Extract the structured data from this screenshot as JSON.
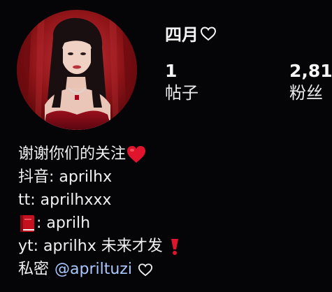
{
  "profile": {
    "username": "四月",
    "username_icon": "heart-outline-icon",
    "avatar": "profile-photo"
  },
  "stats": {
    "posts_count": "1",
    "posts_label": "帖子",
    "followers_count": "2,81",
    "followers_label": "粉丝"
  },
  "bio": {
    "line1_text": "谢谢你们的关注",
    "line1_icon": "red-heart-emoji-icon",
    "line2_text": "抖音: aprilhx",
    "line3_text": "tt: aprilhxxx",
    "line4_icon": "red-book-emoji-icon",
    "line4_text": ": aprilh",
    "line5_text": "yt: aprilhx 未来才发",
    "line5_icon": "red-exclamation-emoji-icon",
    "line6_prefix": "私密",
    "line6_mention": "@apriltuzi",
    "line6_icon": "white-heart-outline-icon"
  },
  "colors": {
    "background": "#050507",
    "text": "#f0f0f0",
    "mention": "#a9c7ff",
    "heart_red": "#e0142d"
  }
}
